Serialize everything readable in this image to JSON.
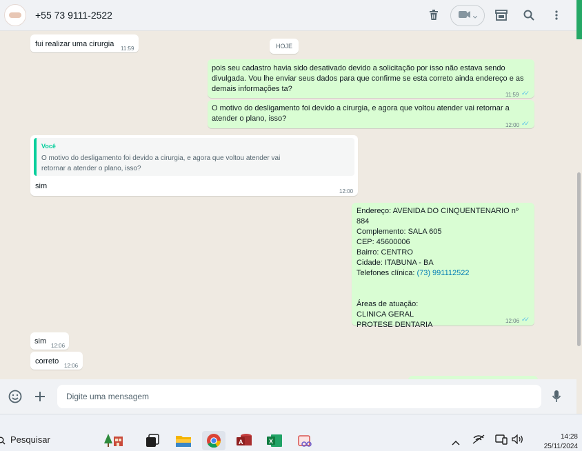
{
  "header": {
    "contact_name": "+55 73 9111-2522"
  },
  "chat": {
    "day_separator": "HOJE",
    "messages": [
      {
        "direction": "in",
        "text": "fui realizar uma cirurgia",
        "time": "11:59"
      },
      {
        "direction": "out",
        "text": "pois seu cadastro havia sido desativado devido a solicitação por isso não estava sendo divulgada. Vou lhe enviar seus dados para que confirme se esta correto ainda endereço e as demais informações ta?",
        "time": "11:59"
      },
      {
        "direction": "out",
        "text": "O motivo do desligamento foi devido a cirurgia, e agora que voltou atender vai retornar a atender o plano, isso?",
        "time": "12:00"
      },
      {
        "direction": "in",
        "quote_author": "Você",
        "quote_text": "O motivo do desligamento foi devido a cirurgia, e agora que voltou atender vai retornar a atender o plano, isso?",
        "text": "sim",
        "time": "12:00"
      },
      {
        "direction": "out",
        "lines": [
          "Endereço: AVENIDA DO CINQUENTENARIO nº 884",
          "Complemento: SALA 605",
          "CEP: 45600006",
          "Bairro: CENTRO",
          "Cidade: ITABUNA - BA"
        ],
        "phone_label": "Telefones clínica: ",
        "phone_link": "(73) 991112522",
        "areas_title": "Áreas de atuação:",
        "areas": [
          "CLINICA GERAL",
          "PROTESE DENTARIA"
        ],
        "time": "12:06"
      },
      {
        "direction": "in",
        "text": "sim",
        "time": "12:06"
      },
      {
        "direction": "in",
        "text": "correto",
        "time": "12:06"
      }
    ]
  },
  "composer": {
    "placeholder": "Digite uma mensagem"
  },
  "taskbar": {
    "search_label": "Pesquisar",
    "time": "14:28",
    "date": "25/11/2024"
  },
  "colors": {
    "incoming_bubble": "#ffffff",
    "outgoing_bubble": "#d9fdd3",
    "accent_green": "#25a866",
    "read_ticks": "#53bdeb",
    "quote_accent": "#06cf9c",
    "link": "#027eb5"
  },
  "icons": [
    "avatar",
    "delete-icon",
    "video-call-icon",
    "shop-icon",
    "search-icon",
    "menu-icon",
    "emoji-icon",
    "plus-icon",
    "mic-icon",
    "search-taskbar-icon",
    "windows-app-icons",
    "chevron-up-icon",
    "network-icon",
    "volume-icon"
  ]
}
